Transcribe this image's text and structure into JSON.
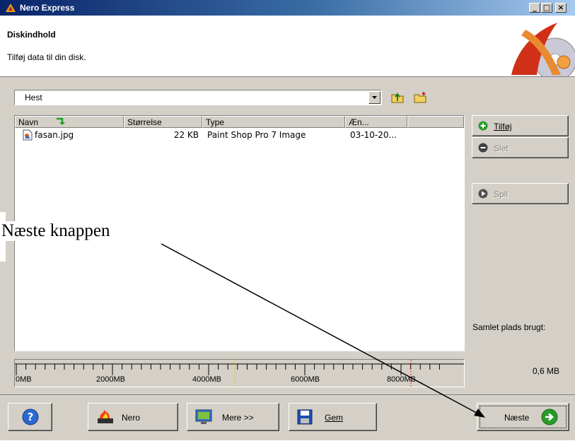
{
  "window": {
    "title": "Nero Express",
    "min": "_",
    "max": "□",
    "close": "×"
  },
  "header": {
    "title": "Diskindhold",
    "subtitle": "Tilføj data til din disk."
  },
  "location": {
    "value": "Hest"
  },
  "columns": [
    "Navn",
    "Størrelse",
    "Type",
    "Æn..."
  ],
  "files": [
    {
      "name": "fasan.jpg",
      "size": "22 KB",
      "type": "Paint Shop Pro 7 Image",
      "date": "03-10-20..."
    }
  ],
  "side_buttons": {
    "add": "Tilføj",
    "delete": "Slet",
    "play": "Spil"
  },
  "capacity": {
    "label": "Samlet plads brugt:",
    "value": "0,6 MB",
    "scale_labels": [
      "0MB",
      "2000MB",
      "4000MB",
      "6000MB",
      "8000MB"
    ]
  },
  "bottom_buttons": {
    "nero": "Nero",
    "more": "Mere >>",
    "save": "Gem",
    "next": "Næste"
  },
  "annotation": {
    "text": "Næste knappen"
  }
}
